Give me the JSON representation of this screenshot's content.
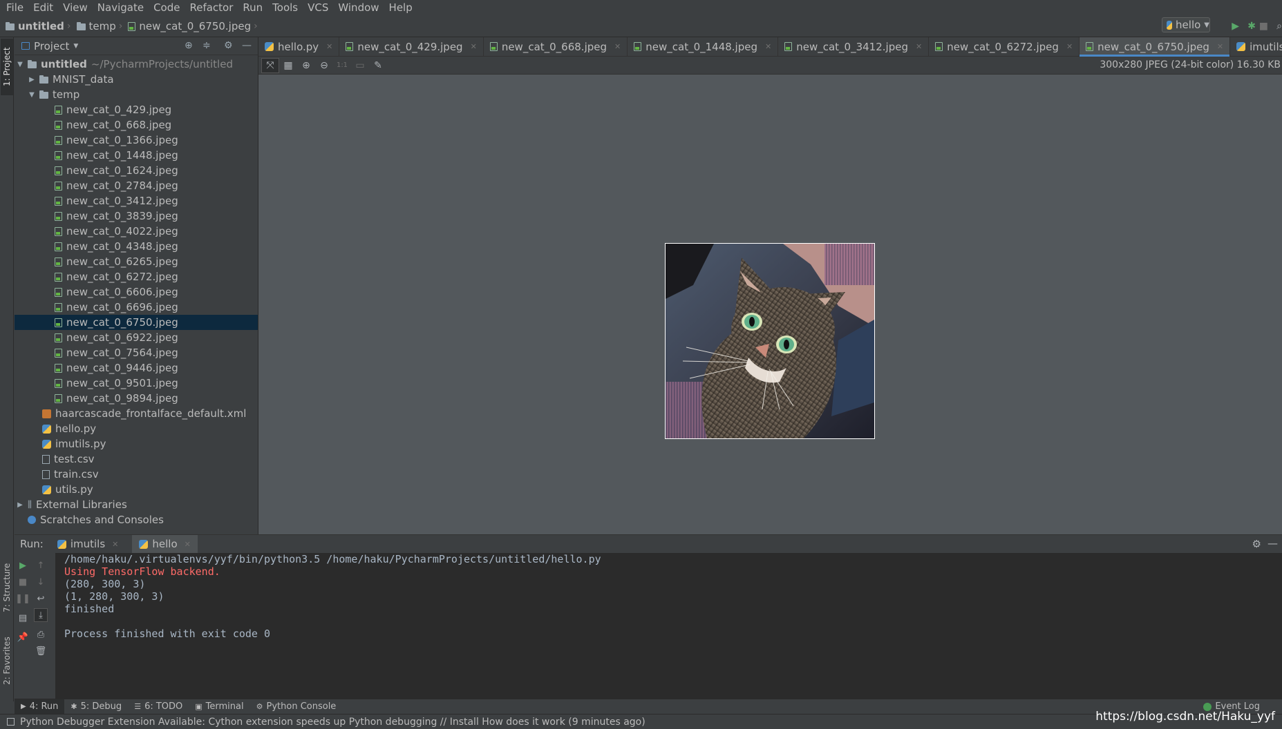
{
  "menu": [
    "File",
    "Edit",
    "View",
    "Navigate",
    "Code",
    "Refactor",
    "Run",
    "Tools",
    "VCS",
    "Window",
    "Help"
  ],
  "breadcrumb": {
    "project": "untitled",
    "folder": "temp",
    "file": "new_cat_0_6750.jpeg"
  },
  "run_config": {
    "label": "hello"
  },
  "left_strip": {
    "project_tab": "1: Project",
    "structure_tab": "7: Structure",
    "favorites_tab": "2: Favorites"
  },
  "project_panel": {
    "title": "Project",
    "root_name": "untitled",
    "root_path": "~/PycharmProjects/untitled",
    "mnist": "MNIST_data",
    "temp": "temp",
    "files": [
      "new_cat_0_429.jpeg",
      "new_cat_0_668.jpeg",
      "new_cat_0_1366.jpeg",
      "new_cat_0_1448.jpeg",
      "new_cat_0_1624.jpeg",
      "new_cat_0_2784.jpeg",
      "new_cat_0_3412.jpeg",
      "new_cat_0_3839.jpeg",
      "new_cat_0_4022.jpeg",
      "new_cat_0_4348.jpeg",
      "new_cat_0_6265.jpeg",
      "new_cat_0_6272.jpeg",
      "new_cat_0_6606.jpeg",
      "new_cat_0_6696.jpeg",
      "new_cat_0_6750.jpeg",
      "new_cat_0_6922.jpeg",
      "new_cat_0_7564.jpeg",
      "new_cat_0_9446.jpeg",
      "new_cat_0_9501.jpeg",
      "new_cat_0_9894.jpeg"
    ],
    "selected": "new_cat_0_6750.jpeg",
    "root_files": [
      "haarcascade_frontalface_default.xml",
      "hello.py",
      "imutils.py",
      "test.csv",
      "train.csv",
      "utils.py"
    ],
    "external": "External Libraries",
    "scratches": "Scratches and Consoles"
  },
  "editor_tabs": [
    "hello.py",
    "new_cat_0_429.jpeg",
    "new_cat_0_668.jpeg",
    "new_cat_0_1448.jpeg",
    "new_cat_0_3412.jpeg",
    "new_cat_0_6272.jpeg",
    "new_cat_0_6750.jpeg",
    "imutils.py"
  ],
  "active_tab": "new_cat_0_6750.jpeg",
  "image_info": "300x280 JPEG (24-bit color) 16.30 KB",
  "image_toolbar": {
    "one_to_one": "1:1"
  },
  "run_panel": {
    "label": "Run:",
    "tabs": [
      "imutils",
      "hello"
    ],
    "console": {
      "line1": "/home/haku/.virtualenvs/yyf/bin/python3.5 /home/haku/PycharmProjects/untitled/hello.py",
      "line2": "Using TensorFlow backend.",
      "line3": "(280, 300, 3)",
      "line4": "(1, 280, 300, 3)",
      "line5": "finished",
      "line6": "",
      "line7": "Process finished with exit code 0"
    }
  },
  "bottom_tabs": [
    "4: Run",
    "5: Debug",
    "6: TODO",
    "Terminal",
    "Python Console"
  ],
  "event_log": "Event Log",
  "status": "Python Debugger Extension Available: Cython extension speeds up Python debugging // Install How does it work (9 minutes ago)",
  "watermark": "https://blog.csdn.net/Haku_yyf"
}
